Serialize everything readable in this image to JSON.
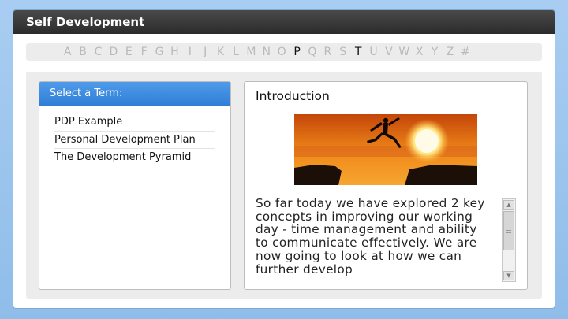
{
  "window": {
    "title": "Self Development"
  },
  "alphabet": [
    {
      "label": "A",
      "active": false
    },
    {
      "label": "B",
      "active": false
    },
    {
      "label": "C",
      "active": false
    },
    {
      "label": "D",
      "active": false
    },
    {
      "label": "E",
      "active": false
    },
    {
      "label": "F",
      "active": false
    },
    {
      "label": "G",
      "active": false
    },
    {
      "label": "H",
      "active": false
    },
    {
      "label": "I",
      "active": false
    },
    {
      "label": "J",
      "active": false
    },
    {
      "label": "K",
      "active": false
    },
    {
      "label": "L",
      "active": false
    },
    {
      "label": "M",
      "active": false
    },
    {
      "label": "N",
      "active": false
    },
    {
      "label": "O",
      "active": false
    },
    {
      "label": "P",
      "active": true
    },
    {
      "label": "Q",
      "active": false
    },
    {
      "label": "R",
      "active": false
    },
    {
      "label": "S",
      "active": false
    },
    {
      "label": "T",
      "active": true
    },
    {
      "label": "U",
      "active": false
    },
    {
      "label": "V",
      "active": false
    },
    {
      "label": "W",
      "active": false
    },
    {
      "label": "X",
      "active": false
    },
    {
      "label": "Y",
      "active": false
    },
    {
      "label": "Z",
      "active": false
    },
    {
      "label": "#",
      "active": false
    }
  ],
  "terms": {
    "header": "Select a Term:",
    "items": [
      {
        "label": "PDP Example"
      },
      {
        "label": "Personal Development Plan"
      },
      {
        "label": "The Development Pyramid"
      }
    ]
  },
  "detail": {
    "title": "Introduction",
    "body": "So far today we have explored 2 key concepts in improving our working day - time management and ability to communicate effectively. We are now going to look at how we can further develop"
  },
  "colors": {
    "titlebar": "#2b2b2b",
    "terms_header": "#3a8ae0",
    "active_letter": "#111111",
    "inactive_letter": "#b9b9b9"
  },
  "icons": {
    "scroll_up": "triangle-up-icon",
    "scroll_down": "triangle-down-icon"
  }
}
